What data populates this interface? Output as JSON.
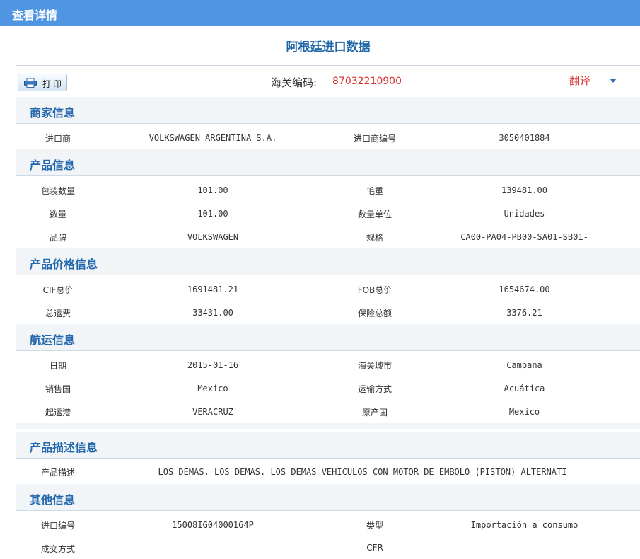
{
  "window": {
    "title": "查看详情"
  },
  "page": {
    "title": "阿根廷进口数据"
  },
  "toolbar": {
    "print_label": "打印",
    "hs_code_label": "海关编码:",
    "hs_code_value": "87032210900",
    "translate_label": "翻译"
  },
  "sections": {
    "merchant": {
      "title": "商家信息",
      "rows": [
        {
          "k1": "进口商",
          "v1": "VOLKSWAGEN ARGENTINA S.A.",
          "k2": "进口商编号",
          "v2": "3050401884"
        }
      ]
    },
    "product": {
      "title": "产品信息",
      "rows": [
        {
          "k1": "包装数量",
          "v1": "101.00",
          "k2": "毛重",
          "v2": "139481.00"
        },
        {
          "k1": "数量",
          "v1": "101.00",
          "k2": "数量单位",
          "v2": "Unidades"
        },
        {
          "k1": "品牌",
          "v1": "VOLKSWAGEN",
          "k2": "规格",
          "v2": "CA00-PA04-PB00-SA01-SB01-"
        }
      ]
    },
    "price": {
      "title": "产品价格信息",
      "rows": [
        {
          "k1": "CIF总价",
          "v1": "1691481.21",
          "k2": "FOB总价",
          "v2": "1654674.00"
        },
        {
          "k1": "总运费",
          "v1": "33431.00",
          "k2": "保险总额",
          "v2": "3376.21"
        }
      ]
    },
    "shipping": {
      "title": "航运信息",
      "rows": [
        {
          "k1": "日期",
          "v1": "2015-01-16",
          "k2": "海关城市",
          "v2": "Campana"
        },
        {
          "k1": "销售国",
          "v1": "Mexico",
          "k2": "运输方式",
          "v2": "Acuática"
        },
        {
          "k1": "起运港",
          "v1": "VERACRUZ",
          "k2": "原产国",
          "v2": "Mexico"
        }
      ]
    },
    "description": {
      "title": "产品描述信息",
      "label": "产品描述",
      "value": "LOS DEMAS. LOS DEMAS. LOS DEMAS VEHICULOS CON MOTOR DE EMBOLO (PISTON) ALTERNATI"
    },
    "other": {
      "title": "其他信息",
      "rows": [
        {
          "k1": "进口编号",
          "v1": "15008IG04000164P",
          "k2": "类型",
          "v2": "Importación a consumo"
        },
        {
          "k1": "成交方式",
          "v1": "",
          "k2": "CFR",
          "v2": ""
        }
      ]
    }
  }
}
